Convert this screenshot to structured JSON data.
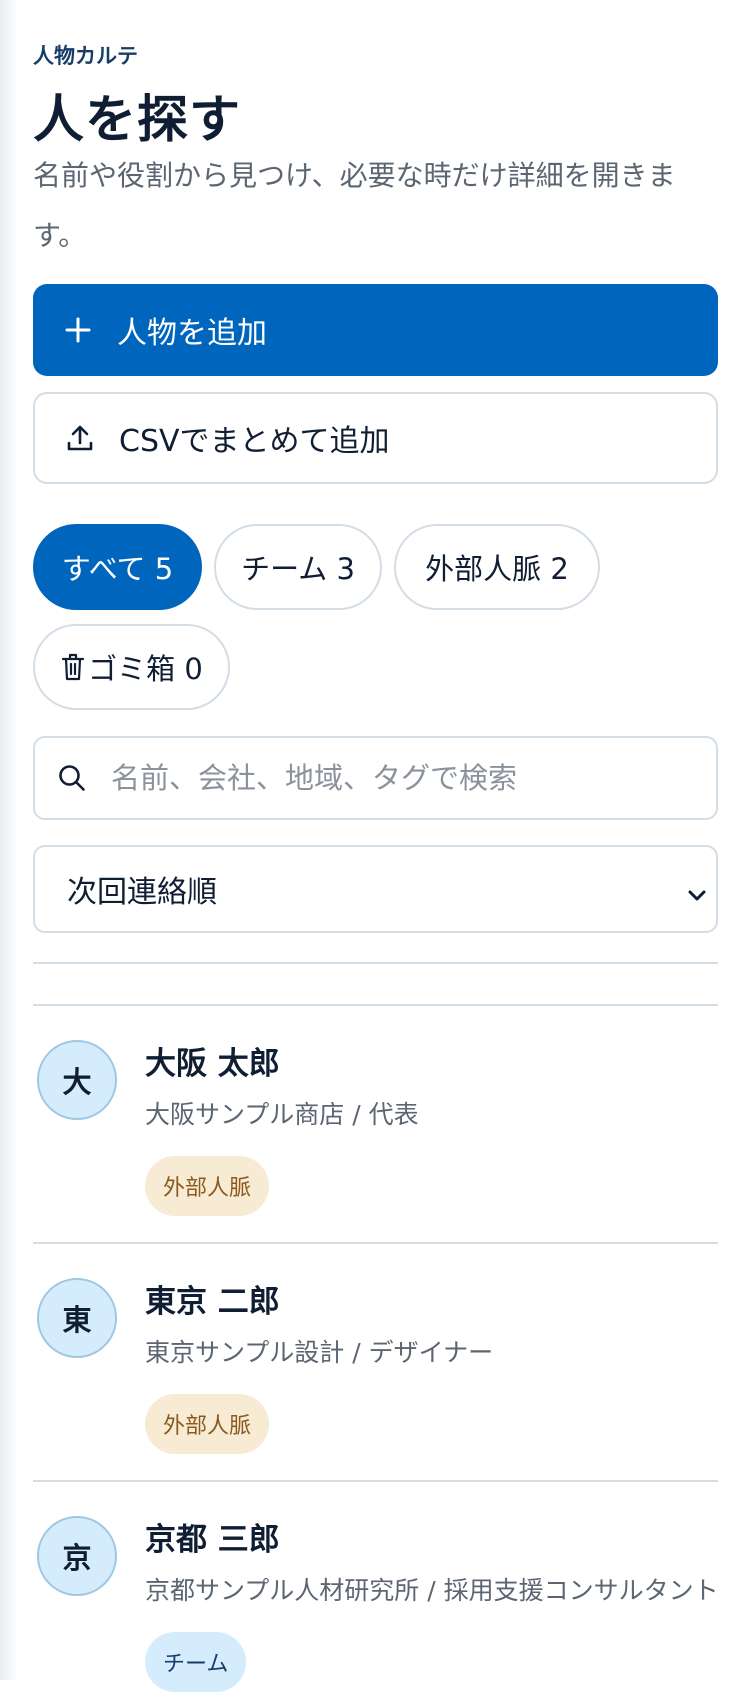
{
  "header": {
    "eyebrow": "人物カルテ",
    "title": "人を探す",
    "subtitle": "名前や役割から見つけ、必要な時だけ詳細を開きます。"
  },
  "actions": {
    "add_person_label": "人物を追加",
    "csv_import_label": "CSVでまとめて追加"
  },
  "filters": [
    {
      "label": "すべて 5",
      "active": true
    },
    {
      "label": "チーム 3",
      "active": false
    },
    {
      "label": "外部人脈 2",
      "active": false
    },
    {
      "label": "ゴミ箱 0",
      "active": false,
      "icon": "trash-icon"
    }
  ],
  "search": {
    "placeholder": "名前、会社、地域、タグで検索",
    "value": ""
  },
  "sort": {
    "selected": "次回連絡順"
  },
  "people": [
    {
      "initial": "大",
      "name": "大阪 太郎",
      "role": "大阪サンプル商店 / 代表",
      "tag": "外部人脈"
    },
    {
      "initial": "東",
      "name": "東京 二郎",
      "role": "東京サンプル設計 / デザイナー",
      "tag": "外部人脈"
    },
    {
      "initial": "京",
      "name": "京都 三郎",
      "role": "京都サンプル人材研究所 / 採用支援コンサルタント",
      "tag": "チーム"
    }
  ],
  "colors": {
    "primary": "#0065bd",
    "border": "#d3dde6",
    "ext_tag_bg": "#f8ebd4",
    "team_tag_bg": "#d4ecfb"
  }
}
